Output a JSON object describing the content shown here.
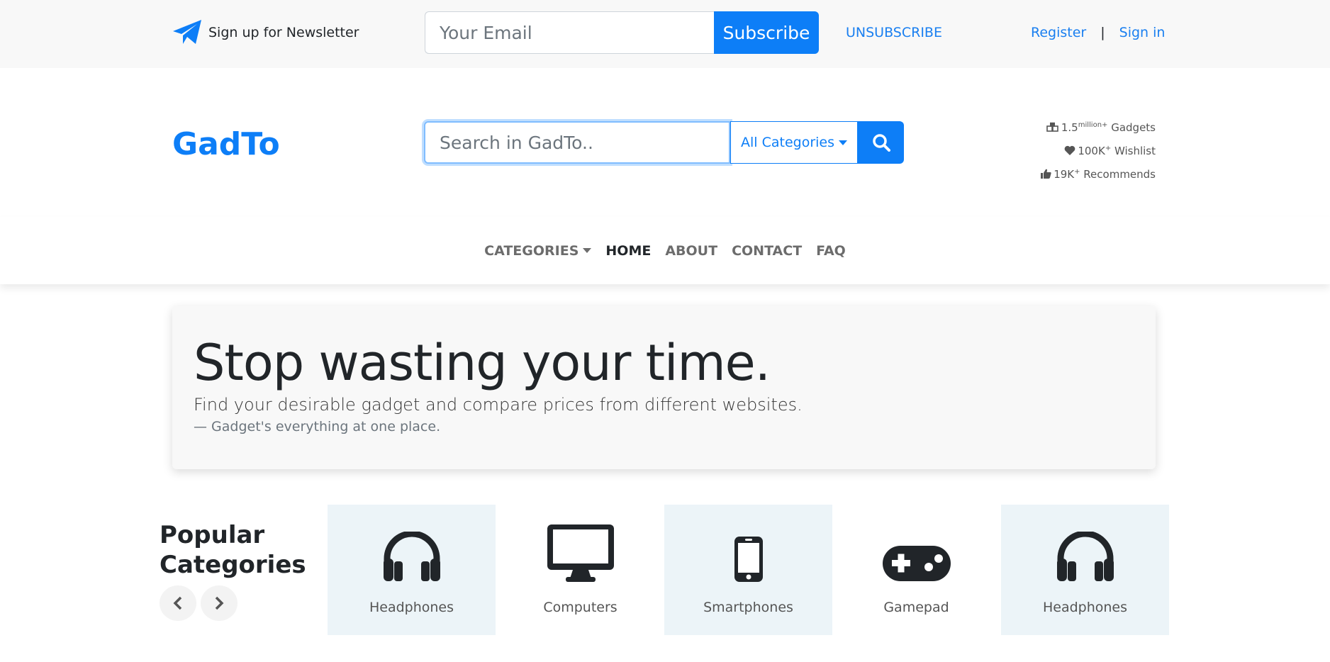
{
  "topbar": {
    "newsletter_label": "Sign up for Newsletter",
    "email_placeholder": "Your Email",
    "subscribe_label": "Subscribe",
    "unsubscribe_label": "UNSUBSCRIBE",
    "register_label": "Register",
    "separator": "|",
    "signin_label": "Sign in"
  },
  "header": {
    "logo": "GadTo",
    "search_placeholder": "Search in GadTo..",
    "category_select": "All Categories",
    "stats": [
      {
        "value": "1.5",
        "sup": "million+",
        "label": " Gadgets",
        "icon": "cubes-icon"
      },
      {
        "value": "100K",
        "sup": "+",
        "label": " Wishlist",
        "icon": "heart-icon"
      },
      {
        "value": "19K",
        "sup": "+",
        "label": " Recommends",
        "icon": "thumbs-up-icon"
      }
    ]
  },
  "nav": {
    "items": [
      {
        "label": "CATEGORIES",
        "dropdown": true
      },
      {
        "label": "HOME",
        "active": true
      },
      {
        "label": "ABOUT"
      },
      {
        "label": "CONTACT"
      },
      {
        "label": "FAQ"
      }
    ]
  },
  "hero": {
    "title": "Stop wasting your time.",
    "lead": "Find your desirable gadget and compare prices from different websites.",
    "tagline": "— Gadget's everything at one place."
  },
  "popular": {
    "title_line1": "Popular",
    "title_line2": "Categories",
    "cards": [
      {
        "label": "Headphones",
        "icon": "headphones-icon"
      },
      {
        "label": "Computers",
        "icon": "desktop-icon"
      },
      {
        "label": "Smartphones",
        "icon": "smartphone-icon"
      },
      {
        "label": "Gamepad",
        "icon": "gamepad-icon"
      },
      {
        "label": "Headphones",
        "icon": "headphones-icon"
      }
    ]
  },
  "colors": {
    "accent": "#0d7ef7",
    "topbar_bg": "#f8f8f8",
    "card_bg": "#ecf4f8"
  }
}
